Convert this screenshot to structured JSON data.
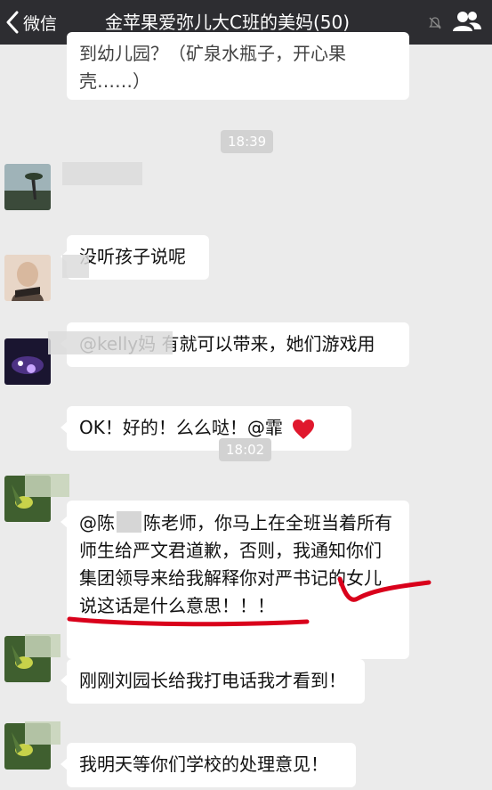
{
  "navbar": {
    "back_label": "微信",
    "title": "金苹果爱弥儿大C班的美妈(50)"
  },
  "messages": {
    "m0_text": "到幼儿园？（矿泉水瓶子，开心果壳……）",
    "time1": "18:39",
    "m1_text": "没听孩子说呢",
    "m2_text": "@kelly妈 有就可以带来，她们游戏用",
    "m3_text": "OK！好的！么么哒！@霏",
    "time2": "18:02",
    "m4_prefix": "@陈",
    "m4_text": "陈老师，你马上在全班当着所有师生给严文君道歉，否则，我通知你们集团领导来给我解释你对严书记的女儿说这话是什么意思！！！",
    "m5_text": "刚刚刘园长给我打电话我才看到！",
    "m6_text": "我明天等你们学校的处理意见！"
  },
  "colors": {
    "navbar": "#2d2d31",
    "background": "#ebebeb",
    "bubble": "#ffffff",
    "annotation": "#d9001b"
  }
}
